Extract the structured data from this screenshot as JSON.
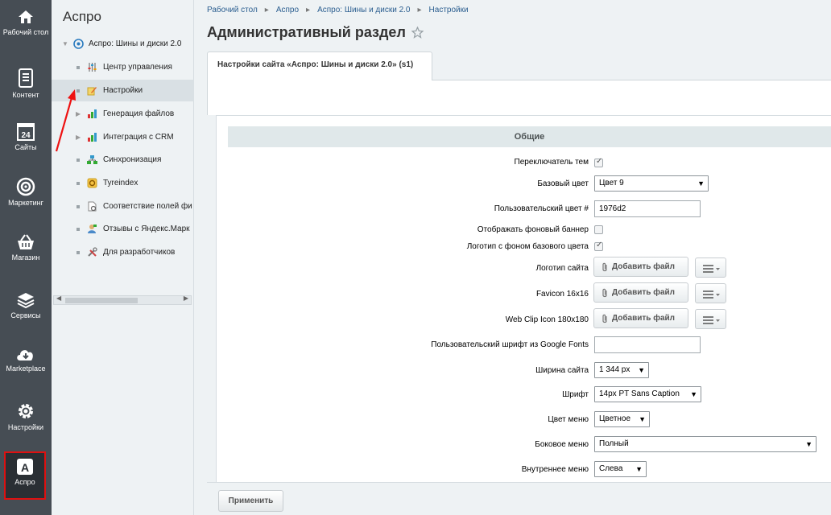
{
  "iconbar": {
    "items": [
      {
        "label": "Рабочий стол",
        "icon": "home-icon"
      },
      {
        "label": "Контент",
        "icon": "document-icon"
      },
      {
        "label": "Сайты",
        "icon": "calendar-icon"
      },
      {
        "label": "Маркетинг",
        "icon": "target-icon"
      },
      {
        "label": "Магазин",
        "icon": "basket-icon"
      },
      {
        "label": "Сервисы",
        "icon": "layers-icon"
      },
      {
        "label": "Marketplace",
        "icon": "cloud-download-icon"
      },
      {
        "label": "Настройки",
        "icon": "gear-icon"
      },
      {
        "label": "Аспро",
        "icon": "aspro-logo-icon"
      }
    ],
    "active_index": 8
  },
  "tree": {
    "title": "Аспро",
    "root": "Аспро: Шины и диски 2.0",
    "items": [
      {
        "label": "Центр управления",
        "icon": "sliders-icon"
      },
      {
        "label": "Настройки",
        "icon": "settings-pencil-icon"
      },
      {
        "label": "Генерация файлов",
        "icon": "chart-icon"
      },
      {
        "label": "Интеграция с CRM",
        "icon": "chart-icon"
      },
      {
        "label": "Синхронизация",
        "icon": "network-icon"
      },
      {
        "label": "Tyreindex",
        "icon": "tyre-icon"
      },
      {
        "label": "Соответствие полей фи",
        "icon": "file-gear-icon"
      },
      {
        "label": "Отзывы с Яндекс.Марк",
        "icon": "user-review-icon"
      },
      {
        "label": "Для разработчиков",
        "icon": "tools-icon"
      }
    ],
    "selected_index": 1
  },
  "breadcrumb": [
    "Рабочий стол",
    "Аспро",
    "Аспро: Шины и диски 2.0",
    "Настройки"
  ],
  "page_title": "Административный раздел",
  "tab": "Настройки сайта «Аспро: Шины и диски 2.0» (s1)",
  "section": "Общие",
  "form": {
    "theme_switch": {
      "label": "Переключатель тем",
      "checked": true
    },
    "base_color": {
      "label": "Базовый цвет",
      "value": "Цвет 9"
    },
    "custom_color": {
      "label": "Пользовательский цвет #",
      "value": "1976d2"
    },
    "show_bg_banner": {
      "label": "Отображать фоновый баннер",
      "checked": false
    },
    "logo_base_bg": {
      "label": "Логотип с фоном базового цвета",
      "checked": true
    },
    "site_logo": {
      "label": "Логотип сайта",
      "button": "Добавить файл"
    },
    "favicon": {
      "label": "Favicon 16x16",
      "button": "Добавить файл"
    },
    "webclip": {
      "label": "Web Clip Icon 180x180",
      "button": "Добавить файл"
    },
    "google_font": {
      "label": "Пользовательский шрифт из Google Fonts",
      "value": ""
    },
    "site_width": {
      "label": "Ширина сайта",
      "value": "1 344 px"
    },
    "font": {
      "label": "Шрифт",
      "value": "14px PT Sans Caption"
    },
    "menu_color": {
      "label": "Цвет меню",
      "value": "Цветное"
    },
    "side_menu": {
      "label": "Боковое меню",
      "value": "Полный"
    },
    "inner_menu": {
      "label": "Внутреннее меню",
      "value": "Слева"
    }
  },
  "apply_label": "Применить",
  "colors": {
    "sidebar": "#464d54",
    "accent_red": "#d11111",
    "link": "#2a5d8f"
  }
}
